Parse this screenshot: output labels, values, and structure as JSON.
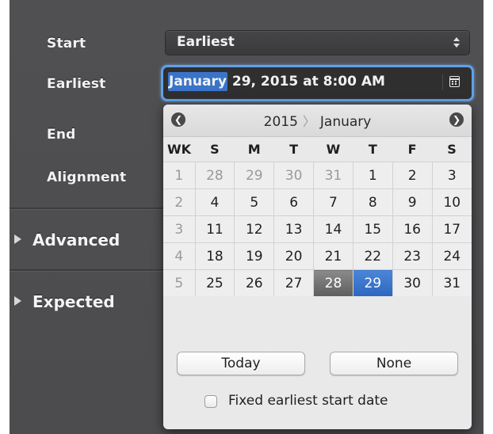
{
  "form": {
    "start_label": "Start",
    "start_value": "Earliest",
    "earliest_label": "Earliest",
    "earliest_value_selected": "January",
    "earliest_value_rest": " 29, 2015 at 8:00 AM",
    "end_label": "End",
    "alignment_label": "Alignment",
    "advanced_label": "Advanced",
    "expected_label": "Expected"
  },
  "calendar": {
    "year": "2015",
    "separator": "〉",
    "month": "January",
    "prev_glyph": "❮",
    "next_glyph": "❯",
    "headers": [
      "WK",
      "S",
      "M",
      "T",
      "W",
      "T",
      "F",
      "S"
    ],
    "weeks": [
      {
        "wk": "1",
        "days": [
          "28",
          "29",
          "30",
          "31",
          "1",
          "2",
          "3"
        ]
      },
      {
        "wk": "2",
        "days": [
          "4",
          "5",
          "6",
          "7",
          "8",
          "9",
          "10"
        ]
      },
      {
        "wk": "3",
        "days": [
          "11",
          "12",
          "13",
          "14",
          "15",
          "16",
          "17"
        ]
      },
      {
        "wk": "4",
        "days": [
          "18",
          "19",
          "20",
          "21",
          "22",
          "23",
          "24"
        ]
      },
      {
        "wk": "5",
        "days": [
          "25",
          "26",
          "27",
          "28",
          "29",
          "30",
          "31"
        ]
      }
    ],
    "today_day": "28",
    "selected_day": "29",
    "today_button": "Today",
    "none_button": "None",
    "fixed_label": "Fixed earliest start date",
    "fixed_checked": false
  },
  "colors": {
    "panel_bg": "#4f4f51",
    "selection_blue": "#3a74c9",
    "focus_ring": "#5fa0e6",
    "today_gray": "#6e6e6e"
  },
  "icons": {
    "popup": "up-down-arrows-icon",
    "datefield": "calendar-icon",
    "prev": "circle-arrow-left-icon",
    "next": "circle-arrow-right-icon",
    "disclosure": "disclosure-triangle-icon"
  }
}
